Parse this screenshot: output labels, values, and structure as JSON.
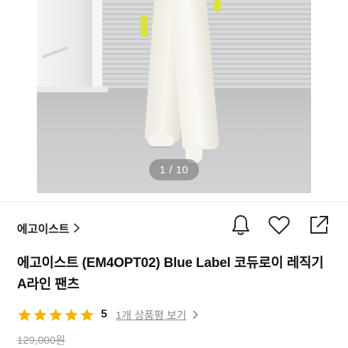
{
  "gallery": {
    "image_counter": "1 / 10"
  },
  "brand": {
    "name": "에고이스트",
    "chevron_icon": "chevron-right-icon"
  },
  "actions": {
    "alert_icon": "bell-icon",
    "wish_icon": "heart-icon",
    "share_icon": "share-icon"
  },
  "product": {
    "title": "에고이스트 (EM4OPT02) Blue Label 코듀로이 레직기 A라인 팬츠",
    "rating": 5,
    "rating_label": "5",
    "stars_filled": 5,
    "review_link": "1개 상품평 보기",
    "original_price": "129,000원"
  },
  "colors": {
    "star": "#f5b400",
    "counter_bg": "#6e6e6e"
  }
}
